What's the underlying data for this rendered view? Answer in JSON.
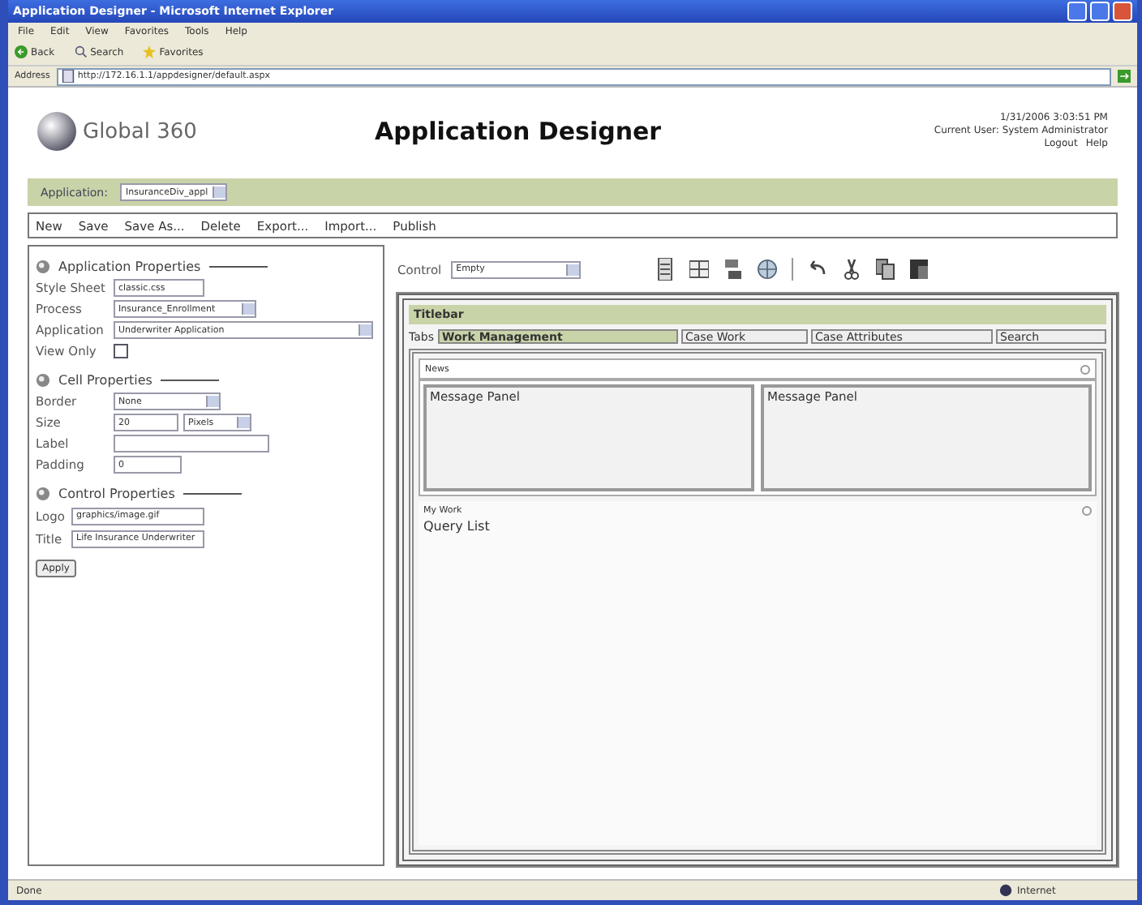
{
  "window": {
    "title": "Application Designer - Microsoft Internet Explorer"
  },
  "menu_bar": [
    "File",
    "Edit",
    "View",
    "Favorites",
    "Tools",
    "Help"
  ],
  "toolbar": {
    "back": "Back",
    "search": "Search",
    "favorites": "Favorites"
  },
  "address_bar": {
    "label": "Address",
    "url": "http://172.16.1.1/appdesigner/default.aspx"
  },
  "header": {
    "logo": "Global 360",
    "title": "Application Designer",
    "datetime": "1/31/2006 3:03:51 PM",
    "user": "Current User: System Administrator",
    "links": [
      "Logout",
      "Help"
    ]
  },
  "app_bar": {
    "label": "Application:",
    "value": "InsuranceDiv_appl"
  },
  "actions": [
    "New",
    "Save",
    "Save As...",
    "Delete",
    "Export...",
    "Import...",
    "Publish"
  ],
  "sections": [
    {
      "title": "Application Properties",
      "fields": [
        {
          "kind": "text",
          "label": "Style Sheet",
          "value": "classic.css"
        },
        {
          "kind": "select",
          "label": "Process",
          "value": "Insurance_Enrollment"
        },
        {
          "kind": "select",
          "label": "Application",
          "value": "Underwriter Application"
        },
        {
          "kind": "checkbox",
          "label": "View Only",
          "checked": false
        }
      ]
    },
    {
      "title": "Cell Properties",
      "fields": [
        {
          "kind": "select",
          "label": "Border",
          "value": "None"
        },
        {
          "kind": "size",
          "label": "Size",
          "value": "20",
          "unit": "Pixels"
        },
        {
          "kind": "text",
          "label": "Label"
        },
        {
          "kind": "text",
          "label": "Padding",
          "value": "0"
        }
      ]
    },
    {
      "title": "Control Properties",
      "fields": [
        {
          "kind": "text",
          "label": "Logo",
          "value": "graphics/image.gif"
        },
        {
          "kind": "text",
          "label": "Title",
          "value": "Life Insurance Underwriter"
        }
      ]
    }
  ],
  "apply_button": "Apply",
  "control": {
    "label": "Control",
    "value": "Empty"
  },
  "designer": {
    "titlebar": "Titlebar",
    "tabs_label": "Tabs",
    "tabs": [
      {
        "label": "Work Management",
        "selected": true
      },
      {
        "label": "Case Work",
        "selected": false
      },
      {
        "label": "Case Attributes",
        "selected": false
      },
      {
        "label": "Search",
        "selected": false
      }
    ],
    "news": {
      "title": "News",
      "panels": [
        "Message Panel",
        "Message Panel"
      ]
    },
    "my_work": {
      "title": "My Work",
      "content": "Query List"
    }
  },
  "status_bar": {
    "left": "Done",
    "zone": "Internet"
  }
}
